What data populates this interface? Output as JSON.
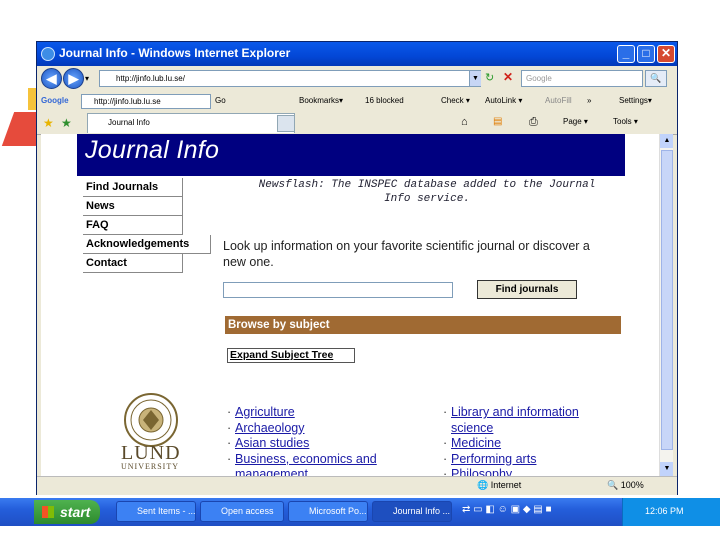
{
  "window": {
    "title": "Journal Info - Windows Internet Explorer",
    "controls": [
      "minimize",
      "maximize",
      "close"
    ]
  },
  "address_bar": {
    "url": "http://jinfo.lub.lu.se/",
    "search_placeholder": "Google"
  },
  "google_toolbar": {
    "logo": "Google",
    "field_value": "http://jinfo.lub.lu.se",
    "go": "Go",
    "bookmarks": "Bookmarks▾",
    "blocked": "16 blocked",
    "check": "Check ▾",
    "autolink": "AutoLink ▾",
    "autofill": "AutoFill",
    "more": "»",
    "settings": "Settings▾"
  },
  "tabs": {
    "active_label": "Journal Info",
    "page_menu": "Page ▾",
    "tools_menu": "Tools ▾"
  },
  "page": {
    "banner_title": "Journal Info",
    "nav": [
      {
        "label": "Find Journals"
      },
      {
        "label": "News"
      },
      {
        "label": "FAQ"
      },
      {
        "label": "Acknowledgements"
      },
      {
        "label": "Contact"
      }
    ],
    "newsflash_line1": "Newsflash: The INSPEC database added to the Journal",
    "newsflash_line2": "Info service.",
    "lookup_text": "Look up information on your favorite scientific journal or discover a new one.",
    "find_button": "Find journals",
    "browse_header": "Browse by subject",
    "expand_button": "Expand Subject Tree",
    "lund_name": "LUND",
    "lund_university": "UNIVERSITY",
    "subjects_left": [
      {
        "bullet": "·",
        "label": "Agriculture"
      },
      {
        "bullet": "·",
        "label": "Archaeology"
      },
      {
        "bullet": "·",
        "label": "Asian studies"
      },
      {
        "bullet": "·",
        "label": "Business, economics and"
      },
      {
        "bullet": "",
        "label": "management"
      }
    ],
    "subjects_right": [
      {
        "bullet": "·",
        "label": "Library and information"
      },
      {
        "bullet": "",
        "label": "science"
      },
      {
        "bullet": "·",
        "label": "Medicine"
      },
      {
        "bullet": "·",
        "label": "Performing arts"
      },
      {
        "bullet": "·",
        "label": "Philosophy"
      }
    ]
  },
  "status_bar": {
    "zone": "Internet",
    "zoom": "100%"
  },
  "taskbar": {
    "start": "start",
    "buttons": [
      {
        "label": "Sent Items - ..."
      },
      {
        "label": "Open access"
      },
      {
        "label": "Microsoft Po..."
      },
      {
        "label": "Journal Info ..."
      }
    ],
    "clock": "12:06 PM"
  },
  "colors": {
    "banner": "#000080",
    "browse_header": "#a06a33",
    "link": "#1a1aa6",
    "titlebar": "#0347d6"
  }
}
